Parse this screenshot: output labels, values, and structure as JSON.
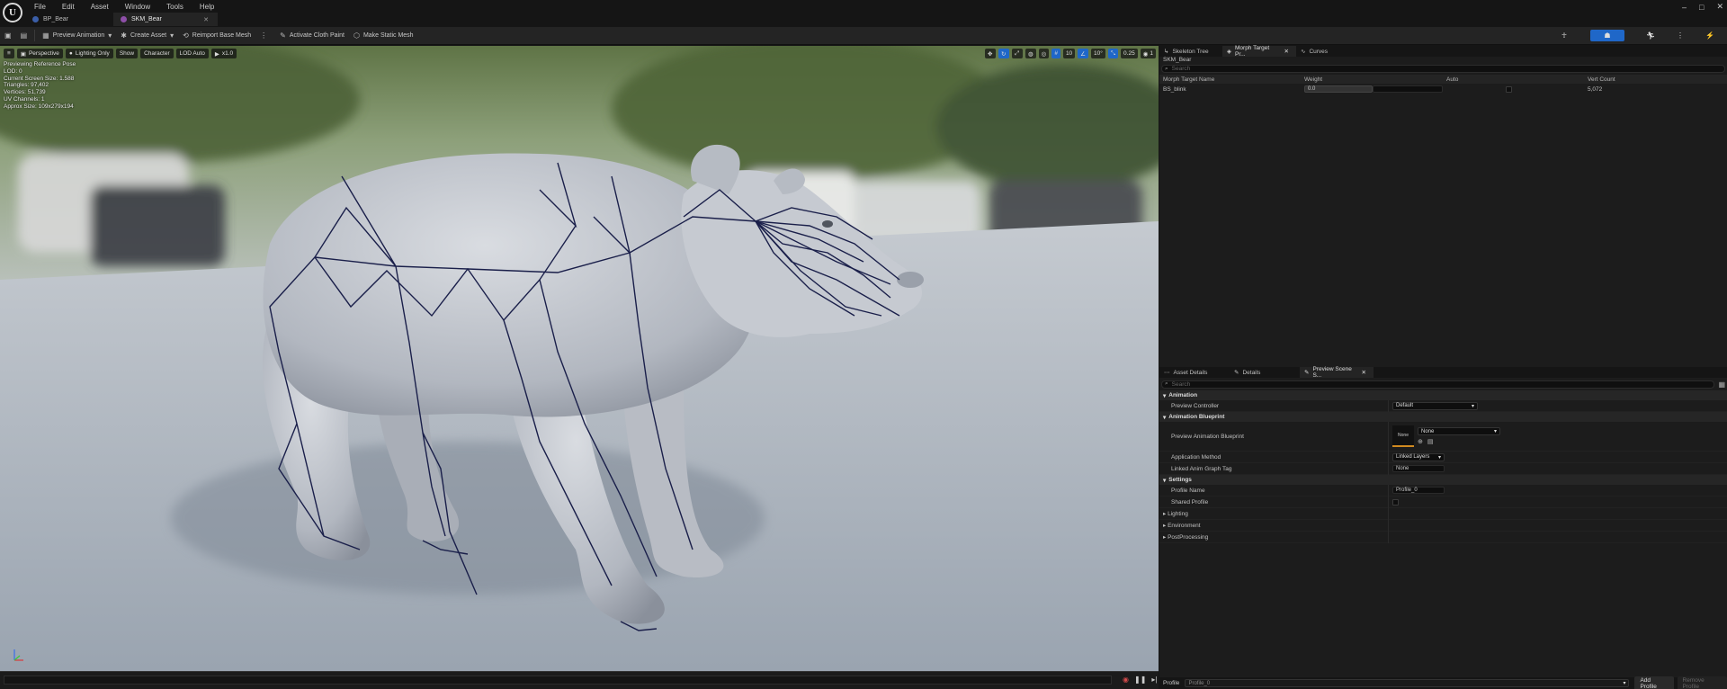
{
  "menu": [
    "File",
    "Edit",
    "Asset",
    "Window",
    "Tools",
    "Help"
  ],
  "tabs": [
    {
      "label": "BP_Bear",
      "dot": "#3b5ea8"
    },
    {
      "label": "SKM_Bear",
      "dot": "#8e4fa8"
    }
  ],
  "toolbar": {
    "preview_animation": "Preview Animation",
    "create_asset": "Create Asset",
    "reimport": "Reimport Base Mesh",
    "cloth_paint": "Activate Cloth Paint",
    "make_static": "Make Static Mesh"
  },
  "viewport": {
    "perspective": "Perspective",
    "lighting": "Lighting Only",
    "show": "Show",
    "character": "Character",
    "lod": "LOD Auto",
    "speed": "x1.0",
    "snap_grid": "10",
    "snap_rot": "10°",
    "snap_scale": "0.25",
    "camera_speed": "1",
    "stats": [
      "Previewing Reference Pose",
      "LOD: 0",
      "Current Screen Size: 1.588",
      "Triangles: 97,402",
      "Vertices: 51,739",
      "UV Channels: 1",
      "Approx Size: 109x279x194"
    ]
  },
  "morph_panel": {
    "tabs": [
      "Skeleton Tree",
      "Morph Target Pr...",
      "Curves"
    ],
    "asset_name": "SKM_Bear",
    "search_placeholder": "Search",
    "columns": [
      "Morph Target Name",
      "Weight",
      "Auto",
      "Vert Count"
    ],
    "rows": [
      {
        "name": "BS_blink",
        "weight": "0.0",
        "auto": false,
        "vert_count": "5,072"
      }
    ]
  },
  "details_panel": {
    "tabs": [
      "Asset Details",
      "Details",
      "Preview Scene S..."
    ],
    "search_placeholder": "Search",
    "sections": {
      "animation": "Animation",
      "animation_blueprint": "Animation Blueprint",
      "settings": "Settings",
      "lighting": "Lighting",
      "environment": "Environment",
      "postprocessing": "PostProcessing"
    },
    "props": {
      "preview_controller_label": "Preview Controller",
      "preview_controller_value": "Default",
      "preview_anim_bp_label": "Preview Animation Blueprint",
      "preview_anim_bp_thumb": "None",
      "preview_anim_bp_value": "None",
      "application_method_label": "Application Method",
      "application_method_value": "Linked Layers",
      "linked_anim_tag_label": "Linked Anim Graph Tag",
      "linked_anim_tag_value": "None",
      "profile_name_label": "Profile Name",
      "profile_name_value": "Profile_0",
      "shared_profile_label": "Shared Profile"
    }
  },
  "bottom": {
    "profile_label": "Profile",
    "profile_value": "Profile_0",
    "add_profile": "Add Profile",
    "remove_profile": "Remove Profile"
  },
  "colors": {
    "accent": "#1f67c8",
    "wire": "#1a1f4a"
  }
}
